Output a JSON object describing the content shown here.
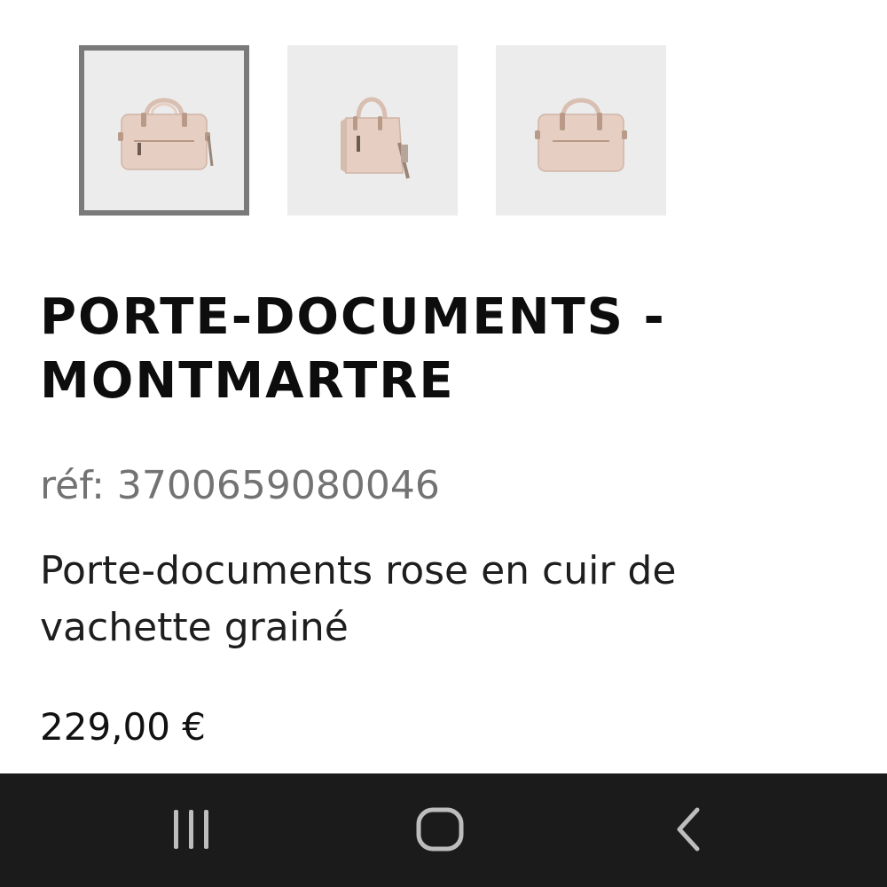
{
  "gallery": {
    "thumbnails": [
      {
        "alt": "front-view",
        "selected": true
      },
      {
        "alt": "side-view",
        "selected": false
      },
      {
        "alt": "back-view",
        "selected": false
      }
    ]
  },
  "product": {
    "title": "PORTE-DOCUMENTS - MONTMARTRE",
    "reference": "réf: 3700659080046",
    "description": "Porte-documents rose en cuir de vachette grainé",
    "price": "229,00 €"
  },
  "navbar": {
    "recents_icon": "recent-apps-icon",
    "home_icon": "home-icon",
    "back_icon": "back-icon"
  },
  "colors": {
    "bag": "#e6cfc2",
    "thumb_bg": "#ececec",
    "selected_border": "#7a7a7a",
    "navbar_bg": "#1b1b1b"
  }
}
